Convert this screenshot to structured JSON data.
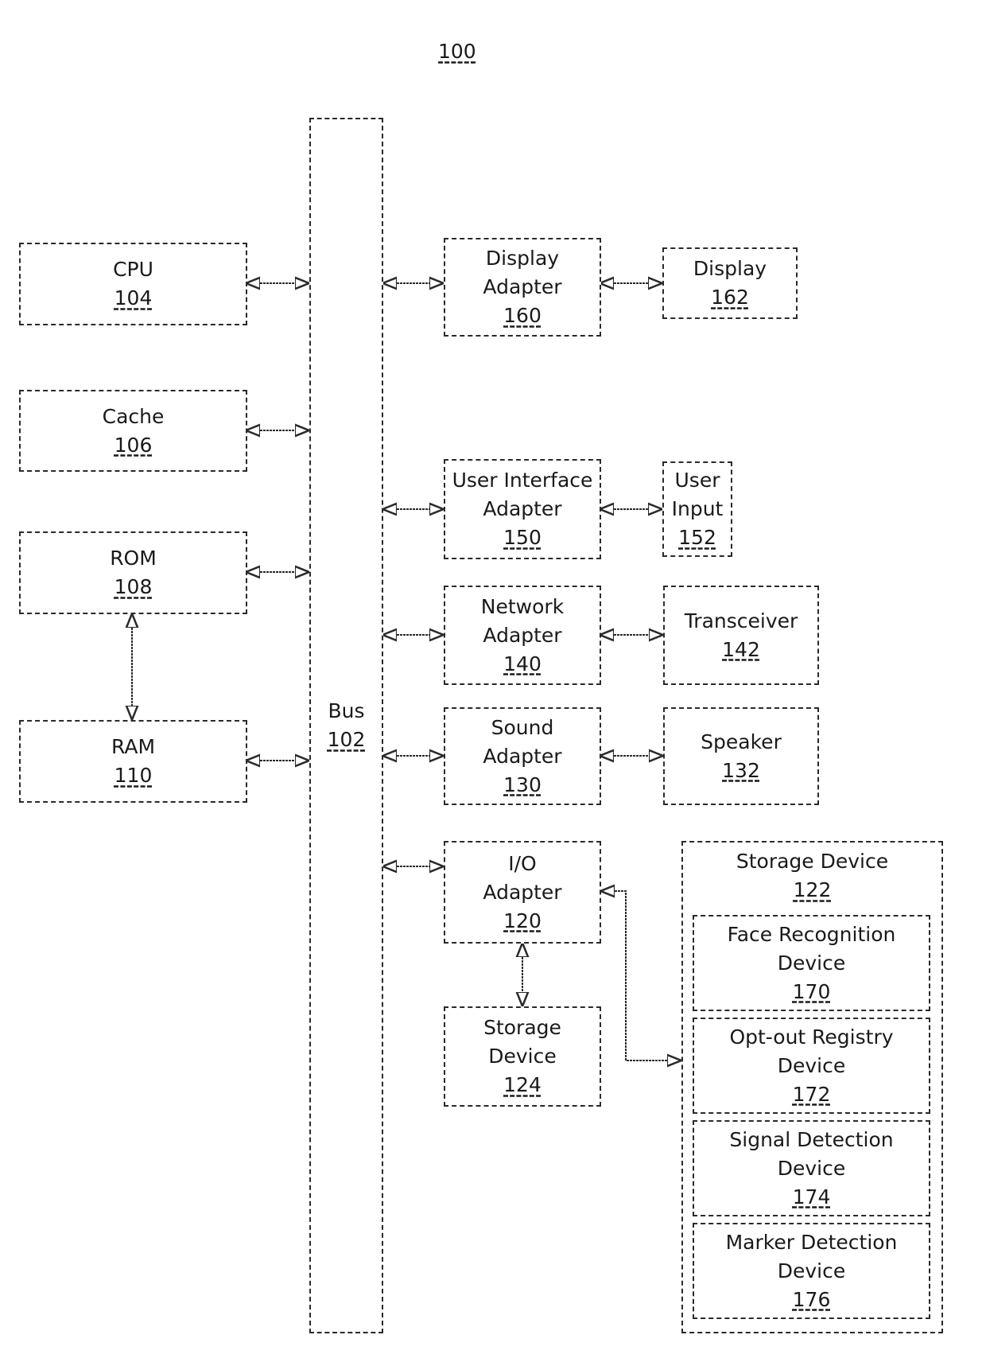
{
  "figure": {
    "reference": "100"
  },
  "bus": {
    "label": "Bus",
    "ref": "102"
  },
  "left_components": [
    {
      "id": "cpu",
      "label": "CPU",
      "ref": "104"
    },
    {
      "id": "cache",
      "label": "Cache",
      "ref": "106"
    },
    {
      "id": "rom",
      "label": "ROM",
      "ref": "108"
    },
    {
      "id": "ram",
      "label": "RAM",
      "ref": "110"
    }
  ],
  "adapters": [
    {
      "id": "display-adapter",
      "lines": [
        "Display",
        "Adapter"
      ],
      "ref": "160"
    },
    {
      "id": "ui-adapter",
      "lines": [
        "User Interface",
        "Adapter"
      ],
      "ref": "150"
    },
    {
      "id": "network-adapter",
      "lines": [
        "Network",
        "Adapter"
      ],
      "ref": "140"
    },
    {
      "id": "sound-adapter",
      "lines": [
        "Sound",
        "Adapter"
      ],
      "ref": "130"
    },
    {
      "id": "io-adapter",
      "lines": [
        "I/O",
        "Adapter"
      ],
      "ref": "120"
    }
  ],
  "peripherals": [
    {
      "id": "display",
      "lines": [
        "Display"
      ],
      "ref": "162"
    },
    {
      "id": "user-input",
      "lines": [
        "User",
        "Input"
      ],
      "ref": "152"
    },
    {
      "id": "transceiver",
      "lines": [
        "Transceiver"
      ],
      "ref": "142"
    },
    {
      "id": "speaker",
      "lines": [
        "Speaker"
      ],
      "ref": "132"
    }
  ],
  "storage_124": {
    "lines": [
      "Storage",
      "Device"
    ],
    "ref": "124"
  },
  "storage_122": {
    "label": "Storage Device",
    "ref": "122",
    "devices": [
      {
        "id": "face-recognition",
        "lines": [
          "Face Recognition",
          "Device"
        ],
        "ref": "170"
      },
      {
        "id": "opt-out-registry",
        "lines": [
          "Opt-out Registry",
          "Device"
        ],
        "ref": "172"
      },
      {
        "id": "signal-detection",
        "lines": [
          "Signal Detection",
          "Device"
        ],
        "ref": "174"
      },
      {
        "id": "marker-detection",
        "lines": [
          "Marker Detection",
          "Device"
        ],
        "ref": "176"
      }
    ]
  },
  "connections": [
    {
      "from": "cpu",
      "to": "bus",
      "type": "bidirectional"
    },
    {
      "from": "cache",
      "to": "bus",
      "type": "bidirectional"
    },
    {
      "from": "rom",
      "to": "bus",
      "type": "bidirectional"
    },
    {
      "from": "ram",
      "to": "bus",
      "type": "bidirectional"
    },
    {
      "from": "rom",
      "to": "ram",
      "type": "bidirectional"
    },
    {
      "from": "bus",
      "to": "display-adapter",
      "type": "bidirectional"
    },
    {
      "from": "bus",
      "to": "ui-adapter",
      "type": "bidirectional"
    },
    {
      "from": "bus",
      "to": "network-adapter",
      "type": "bidirectional"
    },
    {
      "from": "bus",
      "to": "sound-adapter",
      "type": "bidirectional"
    },
    {
      "from": "bus",
      "to": "io-adapter",
      "type": "bidirectional"
    },
    {
      "from": "display-adapter",
      "to": "display",
      "type": "bidirectional"
    },
    {
      "from": "ui-adapter",
      "to": "user-input",
      "type": "bidirectional"
    },
    {
      "from": "network-adapter",
      "to": "transceiver",
      "type": "bidirectional"
    },
    {
      "from": "sound-adapter",
      "to": "speaker",
      "type": "bidirectional"
    },
    {
      "from": "io-adapter",
      "to": "storage-124",
      "type": "bidirectional"
    },
    {
      "from": "io-adapter",
      "to": "storage-122",
      "type": "bidirectional"
    }
  ]
}
